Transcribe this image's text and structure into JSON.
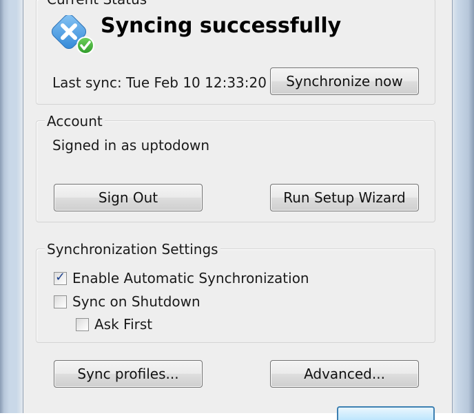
{
  "current_status": {
    "group_title": "Current Status",
    "status_text": "Syncing successfully",
    "status_icon": "sync-ok-icon",
    "last_sync": "Last sync: Tue Feb 10 12:33:20",
    "sync_now_label": "Synchronize now"
  },
  "account": {
    "group_title": "Account",
    "signed_in_text": "Signed in as uptodown",
    "sign_out_label": "Sign Out",
    "setup_wizard_label": "Run Setup Wizard"
  },
  "sync_settings": {
    "group_title": "Synchronization Settings",
    "enable_auto": {
      "label": "Enable Automatic Synchronization",
      "checked": true
    },
    "sync_on_shutdown": {
      "label": "Sync on Shutdown",
      "checked": false
    },
    "ask_first": {
      "label": "Ask First",
      "checked": false
    }
  },
  "footer": {
    "sync_profiles_label": "Sync profiles...",
    "advanced_label": "Advanced..."
  }
}
